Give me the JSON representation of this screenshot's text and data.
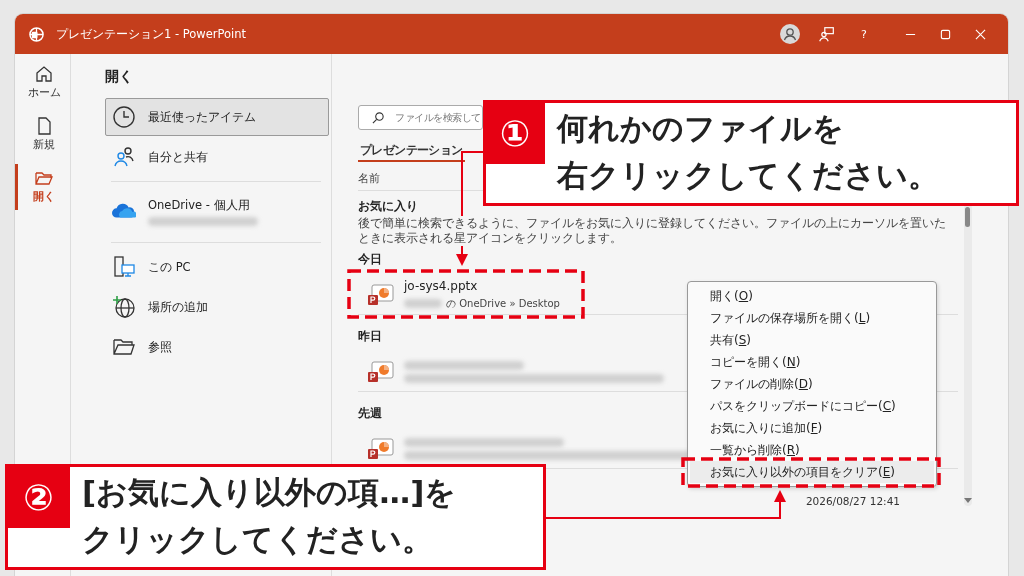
{
  "window": {
    "title": "プレゼンテーション1 - PowerPoint",
    "help": "?"
  },
  "rail": [
    {
      "label": "ホーム",
      "kind": "home",
      "selected": false
    },
    {
      "label": "新規",
      "kind": "new",
      "selected": false
    },
    {
      "label": "開く",
      "kind": "open",
      "selected": true
    }
  ],
  "heading": "開く",
  "location_groups": [
    [
      {
        "label": "最近使ったアイテム",
        "kind": "clock",
        "selected": true
      },
      {
        "label": "自分と共有",
        "kind": "people",
        "selected": false
      }
    ],
    [
      {
        "label": "OneDrive - 個人用",
        "kind": "cloud",
        "selected": false
      }
    ],
    [
      {
        "label": "この PC",
        "kind": "pc",
        "selected": false
      },
      {
        "label": "場所の追加",
        "kind": "globe",
        "selected": false
      },
      {
        "label": "参照",
        "kind": "folder",
        "selected": false
      }
    ]
  ],
  "search": {
    "placeholder": "ファイルを検索して"
  },
  "tabs": [
    {
      "label": "プレゼンテーション",
      "selected": true
    }
  ],
  "columns": {
    "name": "名前"
  },
  "favorites": {
    "title": "お気に入り",
    "description": "後で簡単に検索できるように、ファイルをお気に入りに登録してください。ファイルの上にカーソルを置いたときに表示される星アイコンをクリックします。"
  },
  "groups": [
    {
      "title": "今日",
      "files": [
        {
          "kind": "file",
          "name": "jo-sys4.pptx",
          "location": "の OneDrive » Desktop"
        }
      ]
    },
    {
      "title": "昨日",
      "files": [
        {
          "kind": "blurred"
        }
      ]
    },
    {
      "title": "先週",
      "files": [
        {
          "kind": "blurred"
        },
        {
          "kind": "hidden",
          "date": "2026/08/27 12:41"
        }
      ]
    }
  ],
  "context_menu": [
    {
      "before": "開く(",
      "key": "O",
      "after": ")",
      "selected": false
    },
    {
      "before": "ファイルの保存場所を開く(",
      "key": "L",
      "after": ")",
      "selected": false
    },
    {
      "before": "共有(",
      "key": "S",
      "after": ")",
      "selected": false
    },
    {
      "before": "コピーを開く(",
      "key": "N",
      "after": ")",
      "selected": false
    },
    {
      "before": "ファイルの削除(",
      "key": "D",
      "after": ")",
      "selected": false
    },
    {
      "before": "パスをクリップボードにコピー(",
      "key": "C",
      "after": ")",
      "selected": false
    },
    {
      "before": "お気に入りに追加(",
      "key": "F",
      "after": ")",
      "selected": false
    },
    {
      "before": "一覧から削除(",
      "key": "R",
      "after": ")",
      "selected": false
    },
    {
      "before": "お気に入り以外の項目をクリア(",
      "key": "E",
      "after": ")",
      "selected": true
    }
  ],
  "callouts": [
    {
      "number": "①",
      "lines": [
        "何れかのファイルを",
        "右クリックしてください。"
      ]
    },
    {
      "number": "②",
      "lines": [
        "[お気に入り以外の項…]を",
        "クリックしてください。"
      ]
    }
  ]
}
